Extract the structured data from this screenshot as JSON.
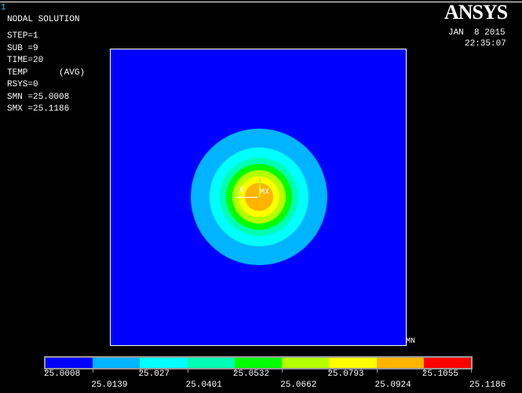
{
  "window_number": "1",
  "title": "NODAL SOLUTION",
  "info": [
    "STEP=1",
    "SUB =9",
    "TIME=20",
    "TEMP      (AVG)",
    "RSYS=0",
    "SMN =25.0008",
    "SMX =25.1186"
  ],
  "logo": "ANSYS",
  "date": "JAN  8 2015",
  "time": "22:35:07",
  "labels": {
    "mx": "MX",
    "mn": "MN",
    "x": "X"
  },
  "legend_colors": [
    "#0000ff",
    "#00b4ff",
    "#00ffff",
    "#00ffb4",
    "#00ff00",
    "#b4ff00",
    "#ffff00",
    "#ffb400",
    "#ff0000"
  ],
  "legend_values_top": [
    "25.0008",
    "25.027",
    "25.0532",
    "25.0793",
    "25.1055"
  ],
  "legend_values_bottom": [
    "25.0139",
    "25.0401",
    "25.0662",
    "25.0924",
    "25.1186"
  ]
}
